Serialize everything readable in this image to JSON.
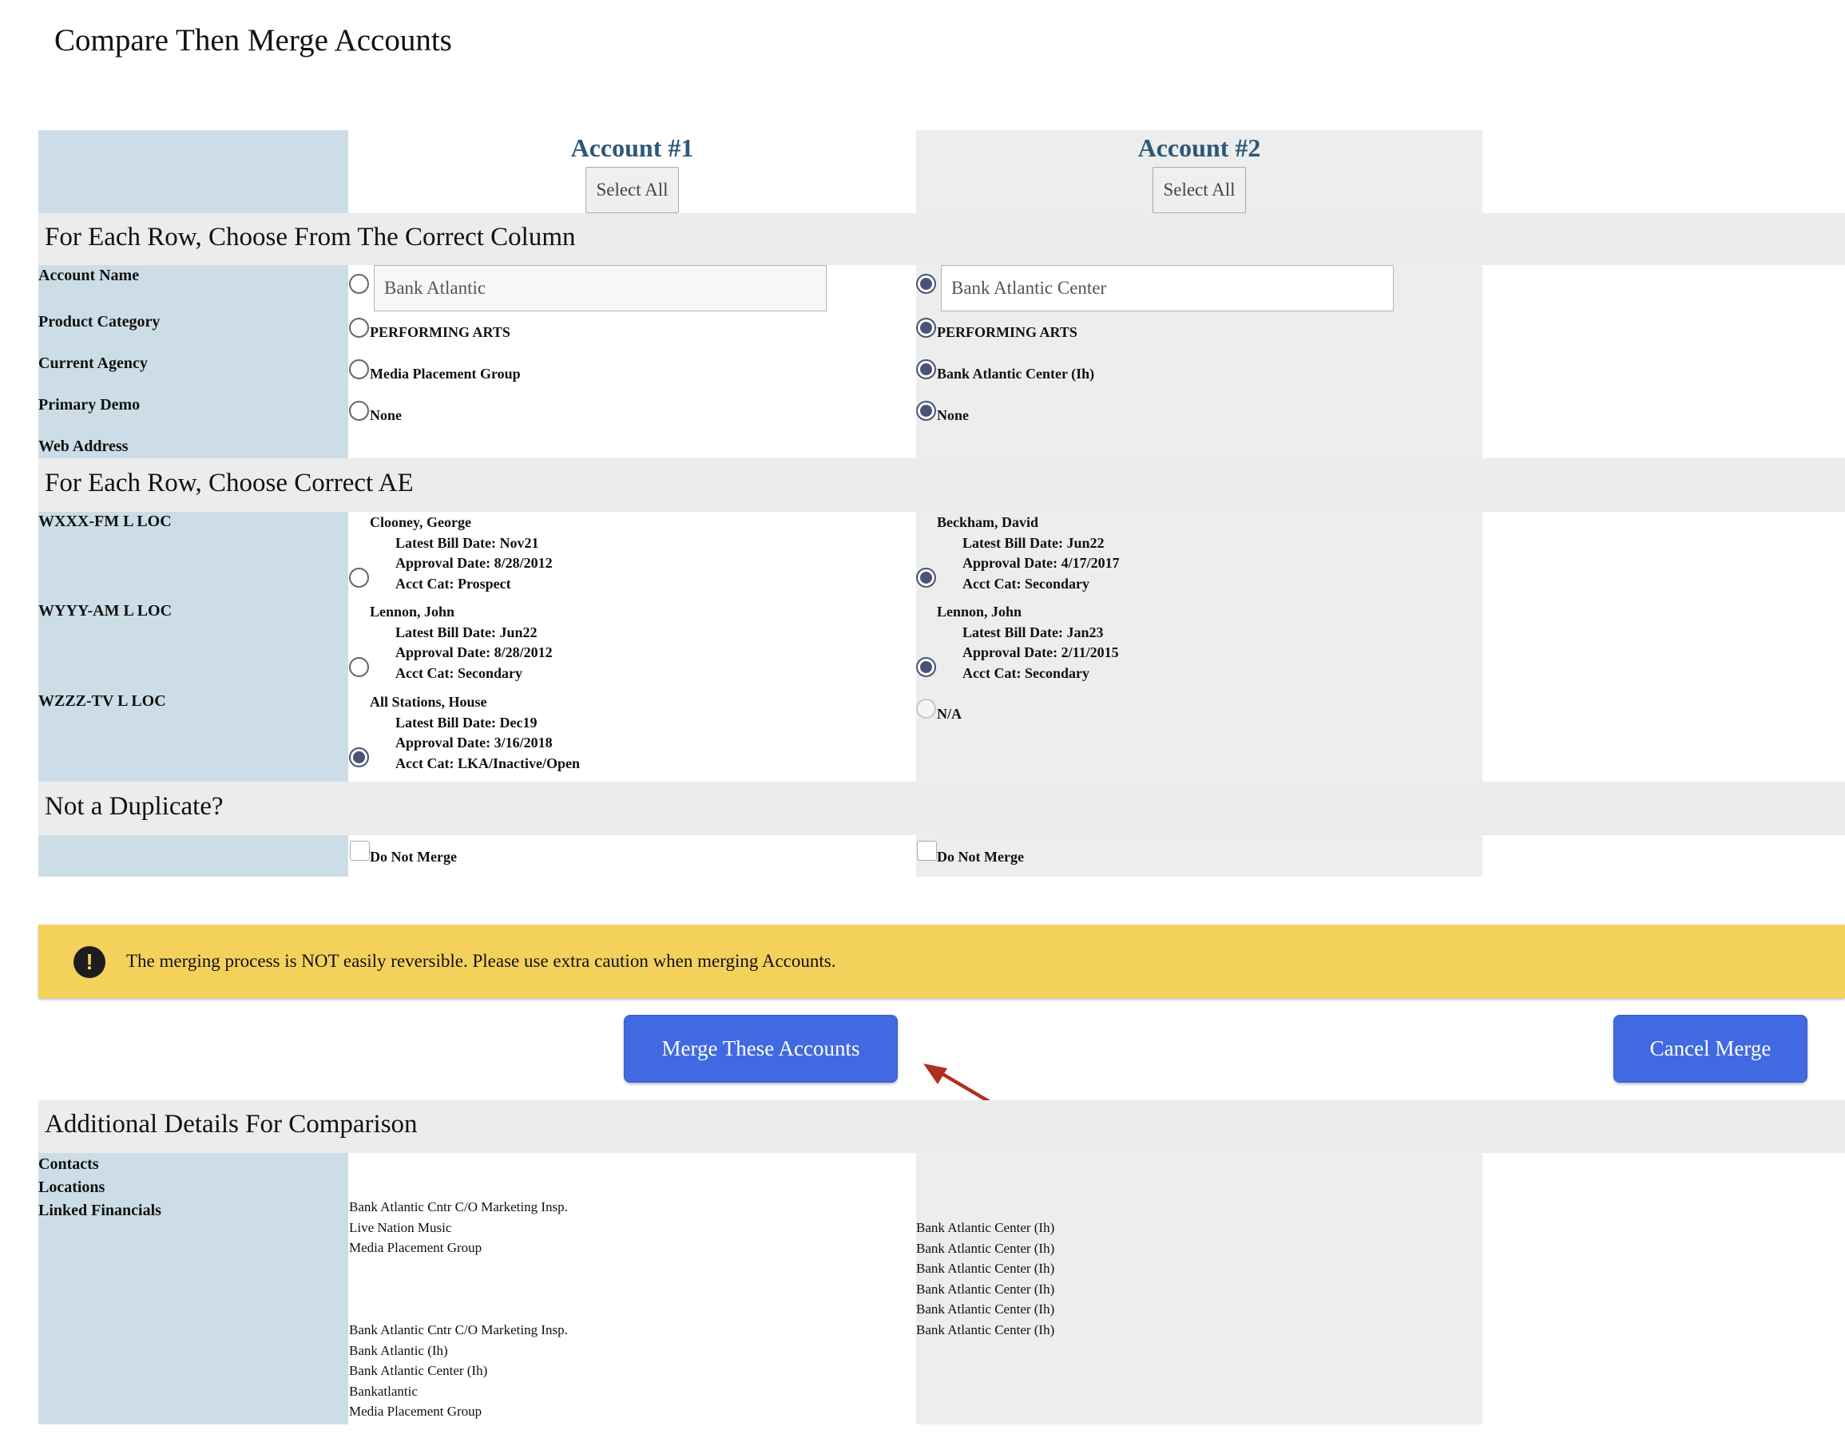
{
  "page": {
    "title": "Compare Then Merge Accounts"
  },
  "columns": {
    "account1": {
      "title": "Account #1",
      "select_all": "Select All"
    },
    "account2": {
      "title": "Account #2",
      "select_all": "Select All"
    }
  },
  "section_fields": {
    "heading": "For Each Row, Choose From The Correct Column",
    "rows": [
      {
        "label": "Account Name",
        "a1": "Bank Atlantic",
        "a1_selected": false,
        "a2": "Bank Atlantic Center",
        "a2_selected": true
      },
      {
        "label": "Product Category",
        "a1": "PERFORMING ARTS",
        "a1_selected": false,
        "a2": "PERFORMING ARTS",
        "a2_selected": true
      },
      {
        "label": "Current Agency",
        "a1": "Media Placement Group",
        "a1_selected": false,
        "a2": "Bank Atlantic Center (Ih)",
        "a2_selected": true
      },
      {
        "label": "Primary Demo",
        "a1": "None",
        "a1_selected": false,
        "a2": "None",
        "a2_selected": true
      },
      {
        "label": "Web Address"
      }
    ]
  },
  "section_ae": {
    "heading": "For Each Row, Choose Correct AE",
    "rows": [
      {
        "label": "WXXX-FM L LOC",
        "a1": {
          "name": "Clooney, George",
          "bill": "Latest Bill Date: Nov21",
          "approval": "Approval Date: 8/28/2012",
          "cat": "Acct Cat: Prospect",
          "selected": false
        },
        "a2": {
          "name": "Beckham, David",
          "bill": "Latest Bill Date: Jun22",
          "approval": "Approval Date: 4/17/2017",
          "cat": "Acct Cat: Secondary",
          "selected": true
        }
      },
      {
        "label": "WYYY-AM L LOC",
        "a1": {
          "name": "Lennon, John",
          "bill": "Latest Bill Date: Jun22",
          "approval": "Approval Date: 8/28/2012",
          "cat": "Acct Cat: Secondary",
          "selected": false
        },
        "a2": {
          "name": "Lennon, John",
          "bill": "Latest Bill Date: Jan23",
          "approval": "Approval Date: 2/11/2015",
          "cat": "Acct Cat: Secondary",
          "selected": true
        }
      },
      {
        "label": "WZZZ-TV L LOC",
        "a1": {
          "name": "All Stations, House",
          "bill": "Latest Bill Date: Dec19",
          "approval": "Approval Date: 3/16/2018",
          "cat": "Acct Cat: LKA/Inactive/Open",
          "selected": true
        },
        "a2": {
          "na": "N/A",
          "disabled": true
        }
      }
    ]
  },
  "section_duplicate": {
    "heading": "Not a Duplicate?",
    "a1_label": "Do Not Merge",
    "a2_label": "Do Not Merge"
  },
  "warning": {
    "icon": "exclamation-icon",
    "glyph": "!",
    "text": "The merging process is NOT easily reversible. Please use extra caution when merging Accounts."
  },
  "buttons": {
    "merge": "Merge These Accounts",
    "cancel": "Cancel Merge"
  },
  "annotation": {
    "arrow_color": "#b0301e"
  },
  "section_details": {
    "heading": "Additional Details For Comparison",
    "labels": [
      "Contacts",
      "Locations",
      "Linked Financials"
    ],
    "a1_group1": [
      "Bank Atlantic Cntr C/O Marketing Insp.",
      "Live Nation Music",
      "Media Placement Group"
    ],
    "a1_group2": [
      "Bank Atlantic Cntr C/O Marketing Insp.",
      "Bank Atlantic (Ih)",
      "Bank Atlantic Center (Ih)",
      "Bankatlantic",
      "Media Placement Group"
    ],
    "a2_list": [
      "Bank Atlantic Center (Ih)",
      "Bank Atlantic Center (Ih)",
      "Bank Atlantic Center (Ih)",
      "Bank Atlantic Center (Ih)",
      "Bank Atlantic Center (Ih)",
      "Bank Atlantic Center (Ih)"
    ]
  },
  "colors": {
    "label_column": "#cddde7",
    "account2_column": "#ededed",
    "section_band": "#ececec",
    "heading_blue": "#2d5877",
    "button_blue": "#4169e1",
    "warning_yellow": "#f4d15b"
  }
}
